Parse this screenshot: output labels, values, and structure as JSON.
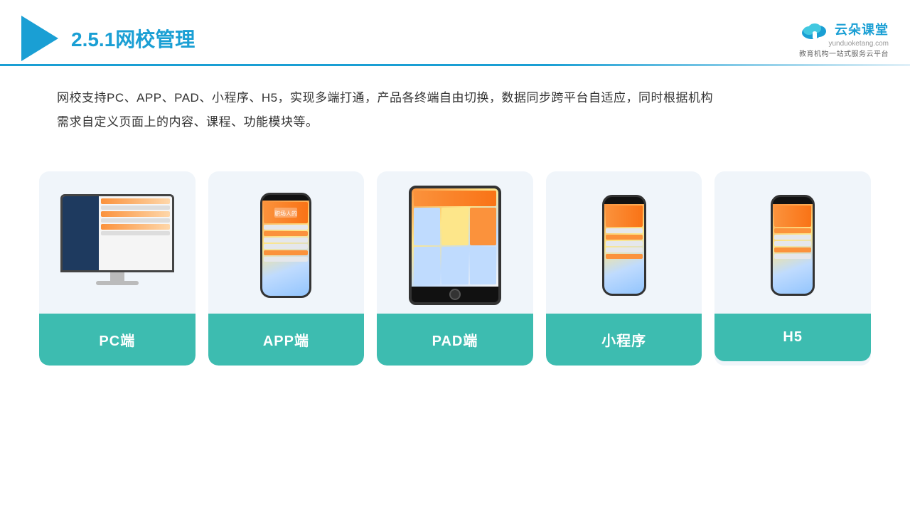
{
  "header": {
    "title_prefix": "2.5.1",
    "title_main": "网校管理",
    "brand_name": "云朵课堂",
    "brand_domain": "yunduoketang.com",
    "brand_tagline": "教育机构一站\n式服务云平台"
  },
  "description": {
    "text": "网校支持PC、APP、PAD、小程序、H5，实现多端打通，产品各终端自由切换，数据同步跨平台自适应，同时根据机构需求自定义页面上的内容、课程、功能模块等。"
  },
  "cards": [
    {
      "id": "pc",
      "label": "PC端"
    },
    {
      "id": "app",
      "label": "APP端"
    },
    {
      "id": "pad",
      "label": "PAD端"
    },
    {
      "id": "miniprogram",
      "label": "小程序"
    },
    {
      "id": "h5",
      "label": "H5"
    }
  ],
  "colors": {
    "accent": "#1a9fd4",
    "teal": "#3dbcb0",
    "divider": "#1a9fd4"
  }
}
